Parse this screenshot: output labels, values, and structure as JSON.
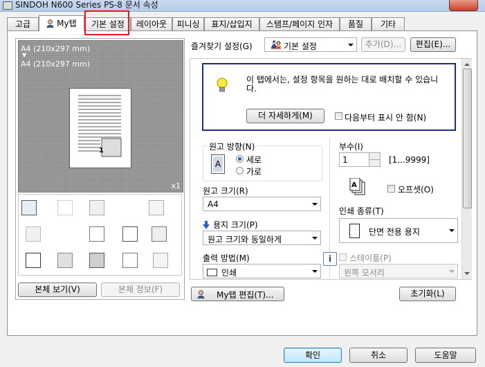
{
  "window": {
    "title": "SINDOH N600 Series PS-8 문서 속성"
  },
  "tabs": [
    {
      "label": "고급"
    },
    {
      "label": "My탭"
    },
    {
      "label": "기본 설정"
    },
    {
      "label": "레이아웃"
    },
    {
      "label": "피니싱"
    },
    {
      "label": "표지/삽입지"
    },
    {
      "label": "스탬프/페이지 인자"
    },
    {
      "label": "품질"
    },
    {
      "label": "기타"
    }
  ],
  "preview": {
    "paper_line1": "A4 (210x297 mm)",
    "arrow": "▼",
    "paper_line2": "A4 (210x297 mm)",
    "page_number": "1",
    "copies_mark": "x1"
  },
  "left_buttons": {
    "body_view": "본체 보기(V)",
    "body_info": "본체 정보(F)"
  },
  "favorites": {
    "label": "즐겨찾기 설정(G)",
    "value": "기본 설정",
    "add": "추가(D)...",
    "edit": "편집(E)..."
  },
  "info_box": {
    "message": "이 탭에서는, 설정 항목을 원하는 대로 배치할 수 있습니다.",
    "more_button": "더 자세하게(M)",
    "hide_label": "다음부터 표시 안 함(N)"
  },
  "orientation": {
    "label": "원고 방향(N)",
    "portrait": "세로",
    "landscape": "가로",
    "selected": "세로"
  },
  "original_size": {
    "label": "원고 크기(R)",
    "value": "A4"
  },
  "paper_size": {
    "label": "용지 크기(P)",
    "value": "원고 크기와 동일하게"
  },
  "output_method": {
    "label": "출력 방법(M)",
    "value": "인쇄"
  },
  "copies": {
    "label": "부수(I)",
    "value": "1",
    "range": "[1...9999]"
  },
  "offset": {
    "label": "오프셋(O)"
  },
  "print_type": {
    "label": "인쇄 종류(T)",
    "value": "단면 전용 용지"
  },
  "staple": {
    "label": "스테이플(P)",
    "value": "왼쪽 모서리"
  },
  "bottom_buttons": {
    "mytab_edit": "My탭 편집(T)...",
    "reset": "초기화(L)"
  },
  "dialog_buttons": {
    "ok": "확인",
    "cancel": "취소",
    "help": "도움말"
  }
}
